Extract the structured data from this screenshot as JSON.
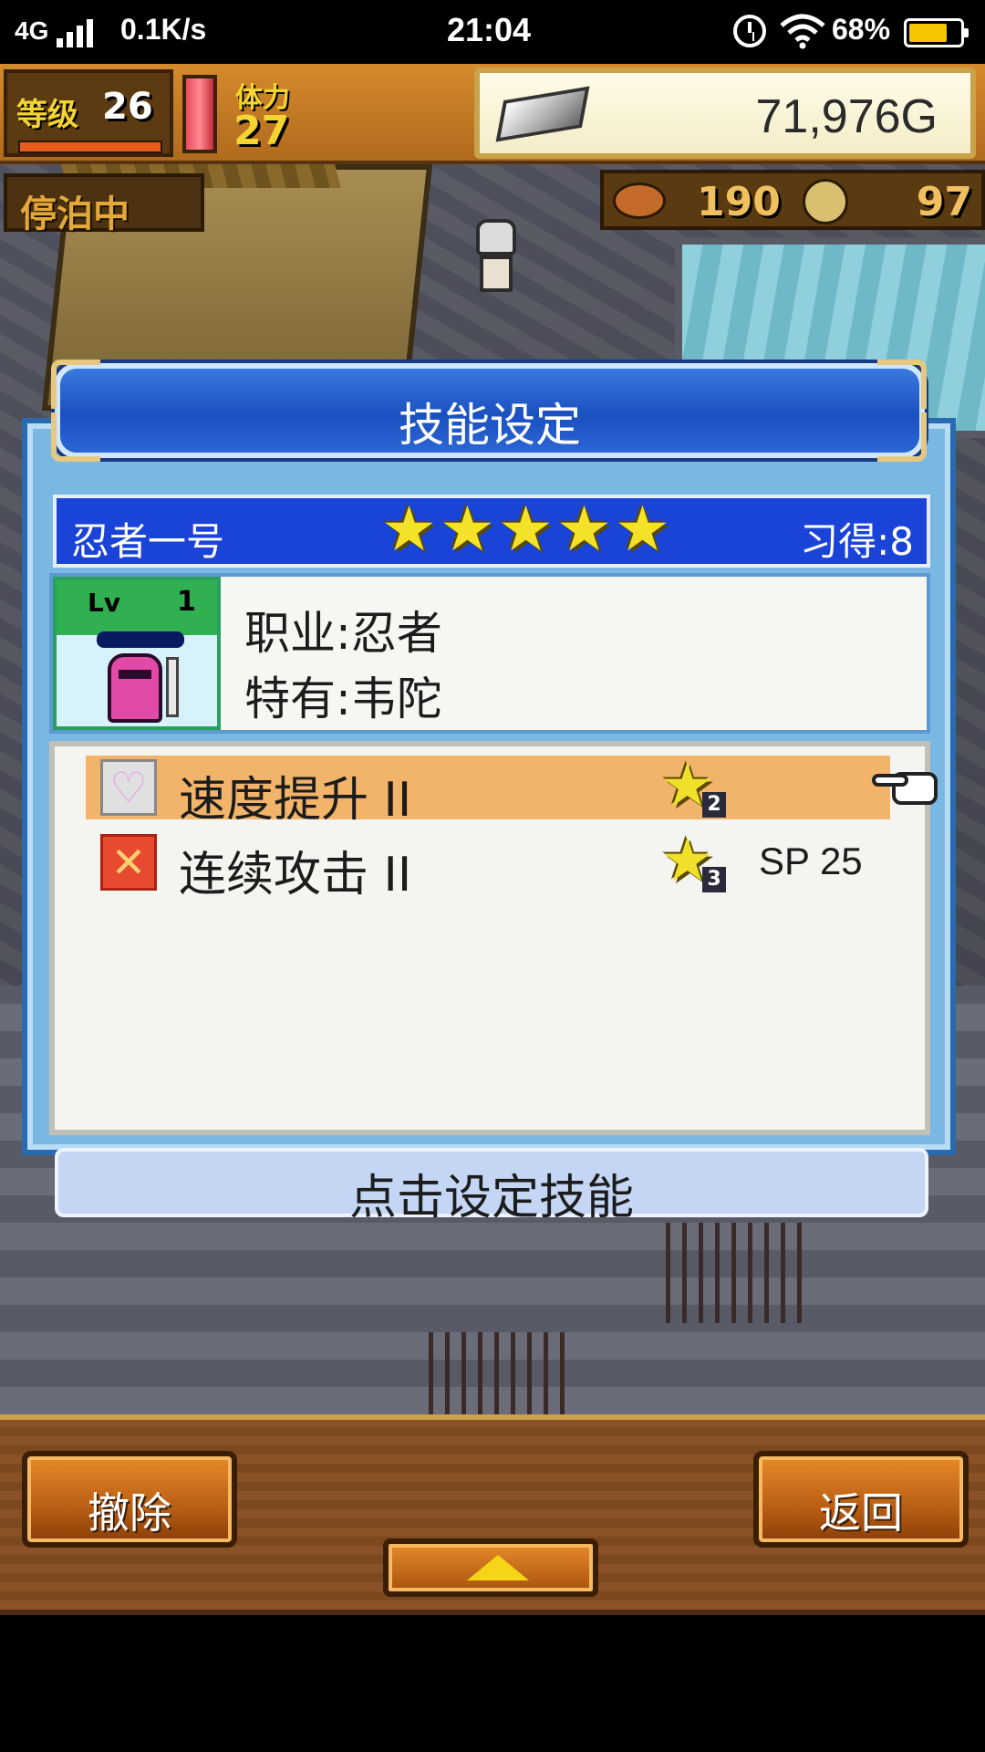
{
  "status_bar": {
    "network": "4G",
    "speed": "0.1K/s",
    "time": "21:04",
    "battery": "68%"
  },
  "hud": {
    "level_label": "等级",
    "level_value": "26",
    "stamina_label": "体力",
    "stamina_value": "27",
    "gold": "71,976G",
    "status": "停泊中",
    "food": "190",
    "coins": "97"
  },
  "dialog": {
    "title": "技能设定",
    "character": {
      "name": "忍者一号",
      "stars": 5,
      "learned": "习得:8",
      "level_label": "Lv",
      "level": "1",
      "job": "职业:忍者",
      "unique": "特有:韦陀"
    },
    "skills": [
      {
        "name": "速度提升 II",
        "icon": "heart-icon",
        "rank": "2",
        "sp": "",
        "selected": true
      },
      {
        "name": "连续攻击 II",
        "icon": "crossed-swords-icon",
        "rank": "3",
        "sp": "SP 25",
        "selected": false
      }
    ],
    "hint": "点击设定技能"
  },
  "toolbar": {
    "remove_label": "撤除",
    "back_label": "返回"
  },
  "colors": {
    "dialog_blue": "#1a44d8",
    "selected_row": "#f2b46a",
    "star_yellow": "#f4e22a",
    "button_orange": "#e88a2a"
  }
}
